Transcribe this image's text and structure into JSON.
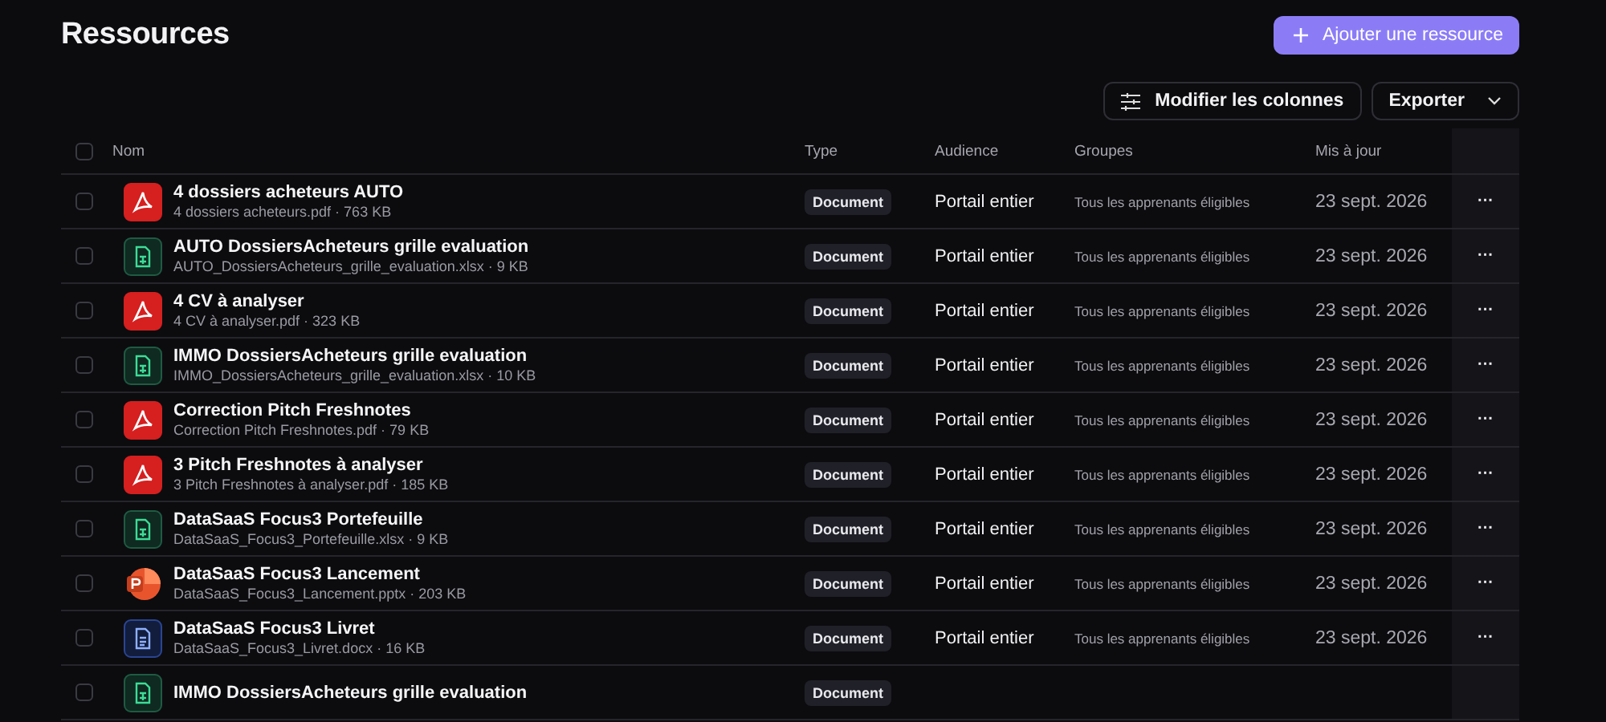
{
  "page": {
    "title": "Ressources",
    "add_button": "Ajouter une ressource"
  },
  "toolbar": {
    "columns_button": "Modifier les colonnes",
    "export_button": "Exporter"
  },
  "table": {
    "select_all": {
      "checked": false
    },
    "columns": [
      "Nom",
      "Type",
      "Audience",
      "Groupes",
      "Mis à jour"
    ],
    "rows": [
      {
        "checked": false,
        "kind": "pdf",
        "name": "4 dossiers acheteurs AUTO",
        "file": "4 dossiers acheteurs.pdf · 763 KB",
        "type": "Document",
        "audience": "Portail entier",
        "groups": "Tous les apprenants éligibles",
        "updated": "23 sept. 2026",
        "actions": "···"
      },
      {
        "checked": false,
        "kind": "xlsx",
        "name": "AUTO DossiersAcheteurs grille evaluation",
        "file": "AUTO_DossiersAcheteurs_grille_evaluation.xlsx · 9 KB",
        "type": "Document",
        "audience": "Portail entier",
        "groups": "Tous les apprenants éligibles",
        "updated": "23 sept. 2026",
        "actions": "···"
      },
      {
        "checked": false,
        "kind": "pdf",
        "name": "4 CV à analyser",
        "file": "4 CV à analyser.pdf · 323 KB",
        "type": "Document",
        "audience": "Portail entier",
        "groups": "Tous les apprenants éligibles",
        "updated": "23 sept. 2026",
        "actions": "···"
      },
      {
        "checked": false,
        "kind": "xlsx",
        "name": "IMMO DossiersAcheteurs grille evaluation",
        "file": "IMMO_DossiersAcheteurs_grille_evaluation.xlsx · 10 KB",
        "type": "Document",
        "audience": "Portail entier",
        "groups": "Tous les apprenants éligibles",
        "updated": "23 sept. 2026",
        "actions": "···"
      },
      {
        "checked": false,
        "kind": "pdf",
        "name": "Correction Pitch Freshnotes",
        "file": "Correction Pitch Freshnotes.pdf · 79 KB",
        "type": "Document",
        "audience": "Portail entier",
        "groups": "Tous les apprenants éligibles",
        "updated": "23 sept. 2026",
        "actions": "···"
      },
      {
        "checked": false,
        "kind": "pdf",
        "name": "3 Pitch Freshnotes à analyser",
        "file": "3 Pitch Freshnotes à analyser.pdf · 185 KB",
        "type": "Document",
        "audience": "Portail entier",
        "groups": "Tous les apprenants éligibles",
        "updated": "23 sept. 2026",
        "actions": "···"
      },
      {
        "checked": false,
        "kind": "xlsx",
        "name": "DataSaaS Focus3 Portefeuille",
        "file": "DataSaaS_Focus3_Portefeuille.xlsx · 9 KB",
        "type": "Document",
        "audience": "Portail entier",
        "groups": "Tous les apprenants éligibles",
        "updated": "23 sept. 2026",
        "actions": "···"
      },
      {
        "checked": false,
        "kind": "pptx",
        "name": "DataSaaS Focus3 Lancement",
        "file": "DataSaaS_Focus3_Lancement.pptx · 203 KB",
        "type": "Document",
        "audience": "Portail entier",
        "groups": "Tous les apprenants éligibles",
        "updated": "23 sept. 2026",
        "actions": "···"
      },
      {
        "checked": false,
        "kind": "docx",
        "name": "DataSaaS Focus3 Livret",
        "file": "DataSaaS_Focus3_Livret.docx · 16 KB",
        "type": "Document",
        "audience": "Portail entier",
        "groups": "Tous les apprenants éligibles",
        "updated": "23 sept. 2026",
        "actions": "···"
      },
      {
        "checked": false,
        "kind": "xlsx",
        "name": "IMMO DossiersAcheteurs grille evaluation",
        "type": "Document"
      }
    ]
  }
}
